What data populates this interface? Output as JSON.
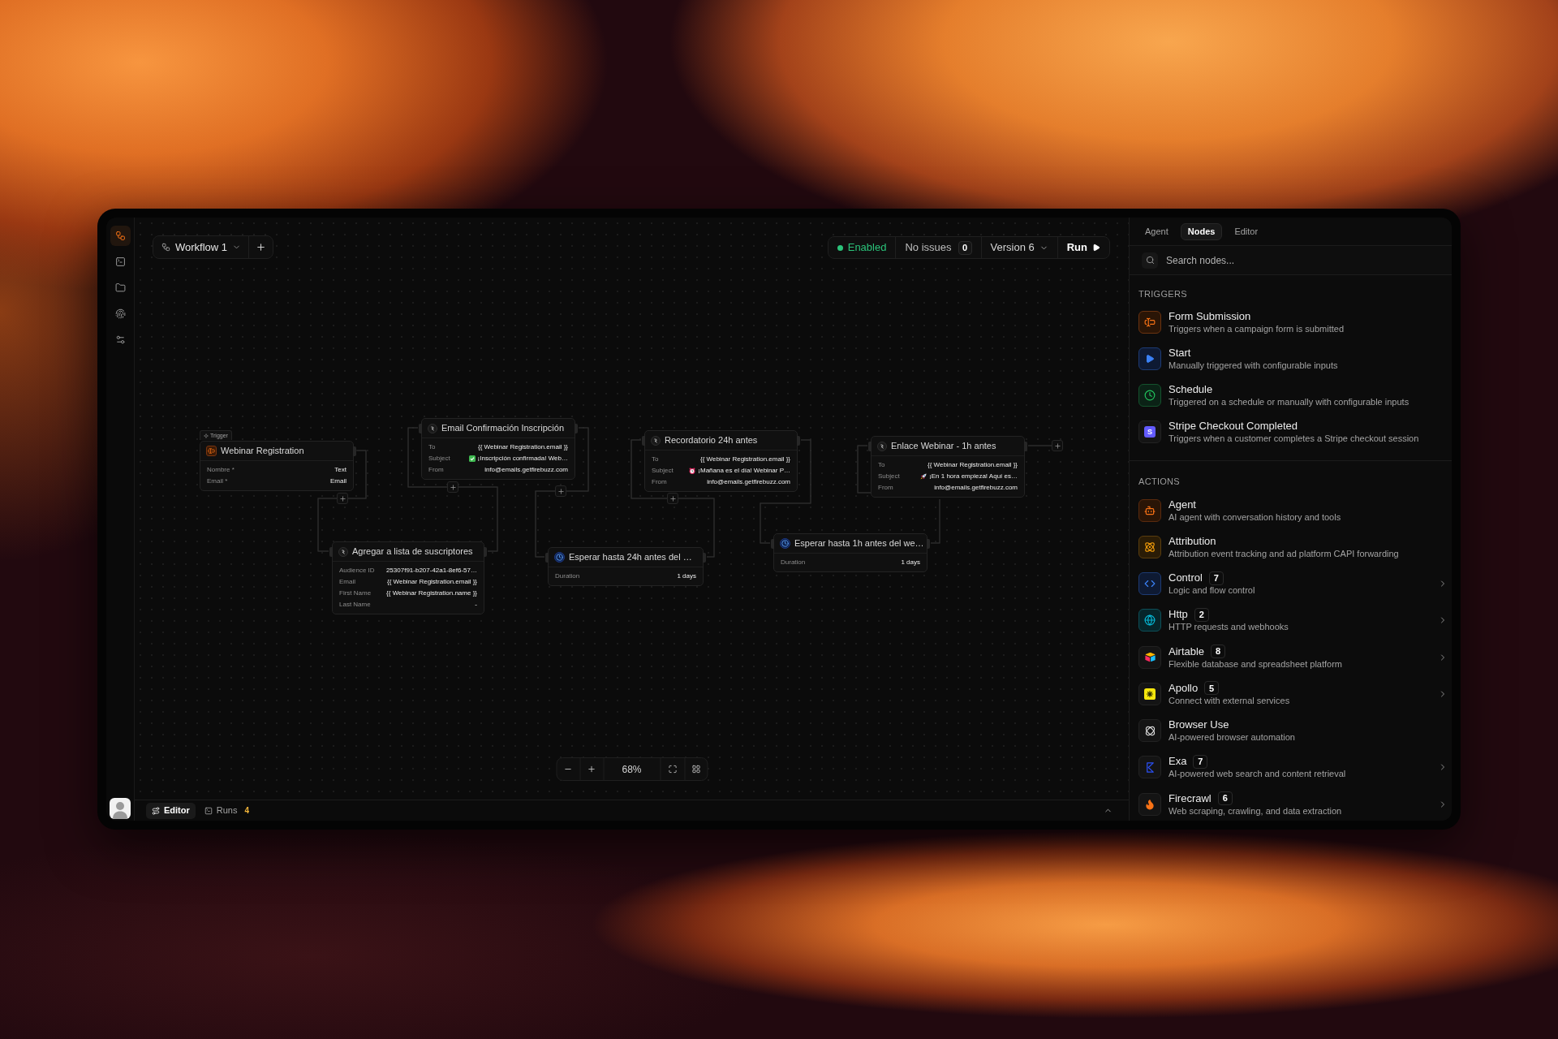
{
  "sidebar": {
    "items": [
      {
        "selected": true
      },
      {
        "selected": false
      },
      {
        "selected": false
      },
      {
        "selected": false
      },
      {
        "selected": false
      }
    ]
  },
  "toolbar": {
    "workflow": "Workflow 1",
    "status": {
      "label": "Enabled",
      "enabled": true
    },
    "issues": {
      "label": "No issues",
      "count": "0"
    },
    "version": "Version 6",
    "run": "Run"
  },
  "canvas": {
    "nodes": [
      {
        "kind": "trigger",
        "badge": "Trigger",
        "title": "Webinar Registration",
        "fields": [
          {
            "label": "Nombre *",
            "value": "Text"
          },
          {
            "label": "Email *",
            "value": "Email"
          }
        ]
      },
      {
        "kind": "action",
        "title": "Email Confirmación Inscripción",
        "fields": [
          {
            "label": "To",
            "value": "{{ Webinar Registration.email }}"
          },
          {
            "label": "Subject",
            "value": "¡Inscripción confirmada! Web…",
            "emoji": true
          },
          {
            "label": "From",
            "value": "info@emails.getfirebuzz.com"
          }
        ]
      },
      {
        "kind": "action",
        "title": "Agregar a lista de suscriptores",
        "fields": [
          {
            "label": "Audience ID",
            "value": "25307f91-b207-42a1-8ef6-57…"
          },
          {
            "label": "Email",
            "value": "{{ Webinar Registration.email }}"
          },
          {
            "label": "First Name",
            "value": "{{ Webinar Registration.name }}"
          },
          {
            "label": "Last Name",
            "value": "-"
          }
        ]
      },
      {
        "kind": "wait",
        "title": "Esperar hasta 24h antes del …",
        "fields": [
          {
            "label": "Duration",
            "value": "1 days"
          }
        ]
      },
      {
        "kind": "action",
        "title": "Recordatorio 24h antes",
        "fields": [
          {
            "label": "To",
            "value": "{{ Webinar Registration.email }}"
          },
          {
            "label": "Subject",
            "value": "¡Mañana es el día! Webinar P…",
            "emoji": true
          },
          {
            "label": "From",
            "value": "info@emails.getfirebuzz.com"
          }
        ]
      },
      {
        "kind": "wait",
        "title": "Esperar hasta 1h antes del we…",
        "fields": [
          {
            "label": "Duration",
            "value": "1 days"
          }
        ]
      },
      {
        "kind": "action",
        "title": "Enlace Webinar - 1h antes",
        "fields": [
          {
            "label": "To",
            "value": "{{ Webinar Registration.email }}"
          },
          {
            "label": "Subject",
            "value": "¡En 1 hora empieza! Aquí es…",
            "emoji": true
          },
          {
            "label": "From",
            "value": "info@emails.getfirebuzz.com"
          }
        ]
      }
    ],
    "zoom": "68%"
  },
  "bottom_bar": {
    "tabs": [
      {
        "label": "Editor",
        "selected": true
      },
      {
        "label": "Runs",
        "count": "4",
        "selected": false
      }
    ]
  },
  "panel": {
    "tabs": [
      {
        "label": "Agent",
        "selected": false
      },
      {
        "label": "Nodes",
        "selected": true
      },
      {
        "label": "Editor",
        "selected": false
      }
    ],
    "search": {
      "placeholder": "Search nodes..."
    },
    "sections": [
      {
        "title": "TRIGGERS",
        "items": [
          {
            "name": "Form Submission",
            "description": "Triggers when a campaign form is submitted"
          },
          {
            "name": "Start",
            "description": "Manually triggered with configurable inputs"
          },
          {
            "name": "Schedule",
            "description": "Triggered on a schedule or manually with configurable inputs"
          },
          {
            "name": "Stripe Checkout Completed",
            "description": "Triggers when a customer completes a Stripe checkout session",
            "logo_letter": "S"
          }
        ]
      },
      {
        "title": "ACTIONS",
        "items": [
          {
            "name": "Agent",
            "description": "AI agent with conversation history and tools"
          },
          {
            "name": "Attribution",
            "description": "Attribution event tracking and ad platform CAPI forwarding"
          },
          {
            "name": "Control",
            "count": "7",
            "description": "Logic and flow control",
            "submenu": true
          },
          {
            "name": "Http",
            "count": "2",
            "description": "HTTP requests and webhooks",
            "submenu": true
          },
          {
            "name": "Airtable",
            "count": "8",
            "description": "Flexible database and spreadsheet platform",
            "submenu": true
          },
          {
            "name": "Apollo",
            "count": "5",
            "description": "Connect with external services",
            "submenu": true
          },
          {
            "name": "Browser Use",
            "description": "AI-powered browser automation"
          },
          {
            "name": "Exa",
            "count": "7",
            "description": "AI-powered web search and content retrieval",
            "submenu": true
          },
          {
            "name": "Firecrawl",
            "count": "6",
            "description": "Web scraping, crawling, and data extraction",
            "submenu": true
          }
        ]
      }
    ]
  }
}
